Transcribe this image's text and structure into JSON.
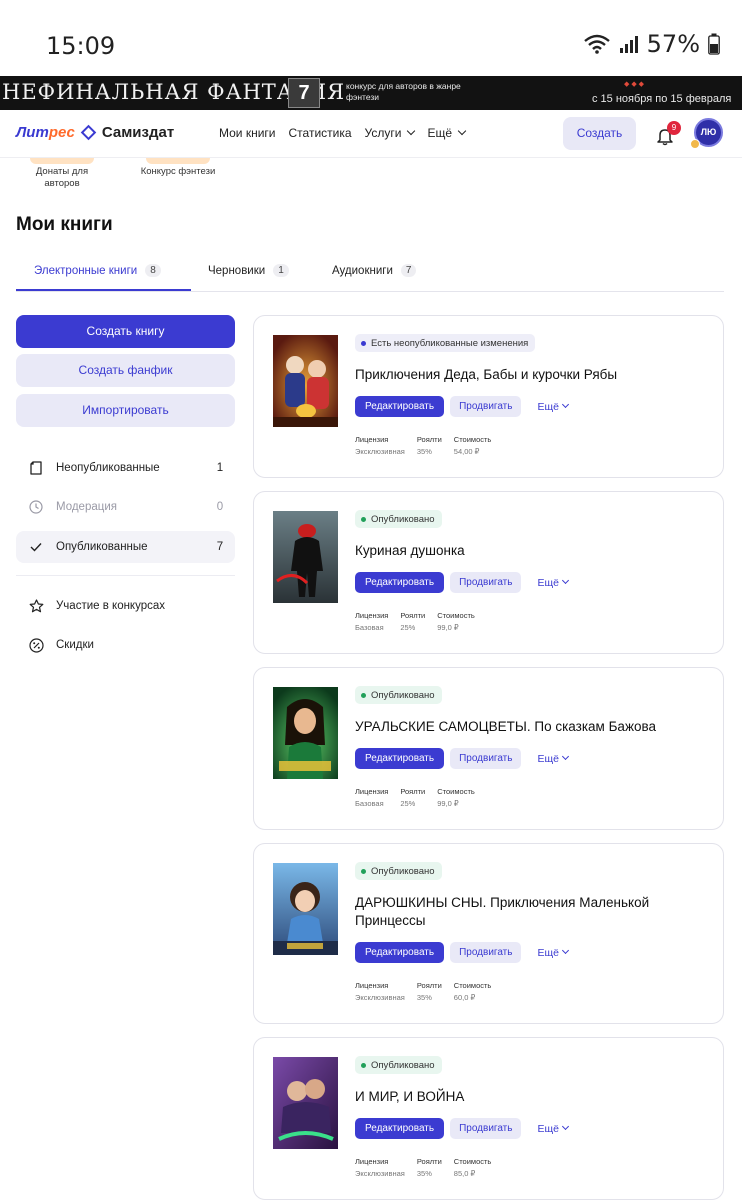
{
  "status_bar": {
    "time": "15:09",
    "battery": "57%"
  },
  "banner": {
    "title": "НЕФИНАЛЬНАЯ ФАНТАЗИЯ",
    "emblem": "7",
    "subtitle": "конкурс для авторов в жанре фэнтези",
    "date": "с 15 ноября по 15 февраля"
  },
  "nav": {
    "logo_part1": "Лит",
    "logo_part2": "рес",
    "logo_part3": "Самиздат",
    "links": [
      "Мои книги",
      "Статистика",
      "Услуги",
      "Ещё"
    ],
    "create_label": "Создать",
    "notifications_count": "9",
    "avatar_initials": "ЛЮ"
  },
  "top_tiles": [
    {
      "label": "Донаты для авторов"
    },
    {
      "label": "Конкурс фэнтези"
    }
  ],
  "page_title": "Мои книги",
  "tabs": [
    {
      "label": "Электронные книги",
      "count": "8"
    },
    {
      "label": "Черновики",
      "count": "1"
    },
    {
      "label": "Аудиокниги",
      "count": "7"
    }
  ],
  "sidebar": {
    "create_book": "Создать книгу",
    "create_fanfic": "Создать фанфик",
    "import": "Импортировать",
    "filters": [
      {
        "label": "Неопубликованные",
        "count": "1"
      },
      {
        "label": "Модерация",
        "count": "0"
      },
      {
        "label": "Опубликованные",
        "count": "7"
      }
    ],
    "links": [
      {
        "label": "Участие в конкурсах"
      },
      {
        "label": "Скидки"
      }
    ]
  },
  "card_labels": {
    "edit": "Редактировать",
    "promote": "Продвигать",
    "more": "Ещё",
    "license": "Лицензия",
    "royalty": "Роялти",
    "price": "Стоимость"
  },
  "books": [
    {
      "status": "Есть неопубликованные изменения",
      "title": "Приключения Деда, Бабы и курочки Рябы",
      "license": "Эксклюзивная",
      "royalty": "35%",
      "price": "54,00 ₽"
    },
    {
      "status": "Опубликовано",
      "title": "Куриная душонка",
      "license": "Базовая",
      "royalty": "25%",
      "price": "99,0 ₽"
    },
    {
      "status": "Опубликовано",
      "title": "УРАЛЬСКИЕ САМОЦВЕТЫ. По сказкам Бажова",
      "license": "Базовая",
      "royalty": "25%",
      "price": "99,0 ₽"
    },
    {
      "status": "Опубликовано",
      "title": "ДАРЮШКИНЫ СНЫ. Приключения Маленькой Принцессы",
      "license": "Эксклюзивная",
      "royalty": "35%",
      "price": "60,0 ₽"
    },
    {
      "status": "Опубликовано",
      "title": "И МИР, И ВОЙНА",
      "license": "Эксклюзивная",
      "royalty": "35%",
      "price": "85,0 ₽"
    }
  ],
  "colors": {
    "accent": "#3b3bd1",
    "brand_orange": "#ff6a2b",
    "published": "#22a05a"
  }
}
